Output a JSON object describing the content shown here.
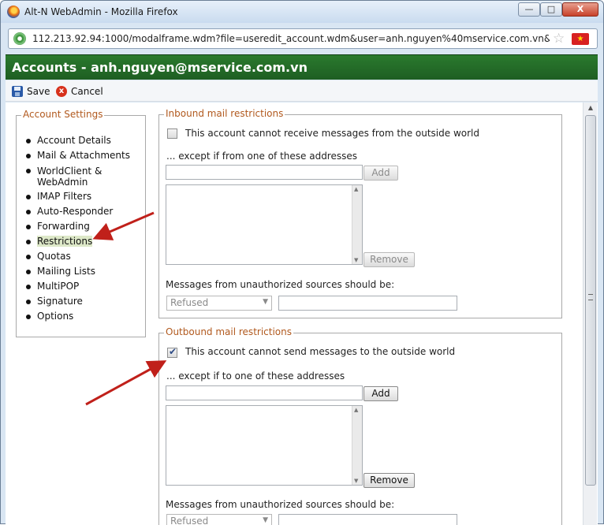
{
  "window": {
    "title": "Alt-N WebAdmin - Mozilla Firefox",
    "min_glyph": "—",
    "max_glyph": "□",
    "close_glyph": "X"
  },
  "address_bar": {
    "url": "112.213.92.94:1000/modalframe.wdm?file=useredit_account.wdm&user=anh.nguyen%40mservice.com.vn&domain=mserv",
    "star_glyph": "☆",
    "flag_glyph": "★"
  },
  "page": {
    "title": "Accounts - anh.nguyen@mservice.com.vn"
  },
  "toolbar": {
    "save_label": "Save",
    "cancel_label": "Cancel",
    "cancel_glyph": "x"
  },
  "nav": {
    "legend": "Account Settings",
    "items": [
      {
        "label": "Account Details"
      },
      {
        "label": "Mail & Attachments"
      },
      {
        "label": "WorldClient & WebAdmin"
      },
      {
        "label": "IMAP Filters"
      },
      {
        "label": "Auto-Responder"
      },
      {
        "label": "Forwarding"
      },
      {
        "label": "Restrictions",
        "active": true
      },
      {
        "label": "Quotas"
      },
      {
        "label": "Mailing Lists"
      },
      {
        "label": "MultiPOP"
      },
      {
        "label": "Signature"
      },
      {
        "label": "Options"
      }
    ]
  },
  "inbound": {
    "legend": "Inbound mail restrictions",
    "checkbox_label": "This account cannot receive messages from the outside world",
    "checked": false,
    "except_label": "... except if from one of these addresses",
    "address_value": "",
    "add_label": "Add",
    "remove_label": "Remove",
    "unauth_label": "Messages from unauthorized sources should be:",
    "unauth_selected": "Refused",
    "extra_value": ""
  },
  "outbound": {
    "legend": "Outbound mail restrictions",
    "checkbox_label": "This account cannot send messages to the outside world",
    "checked": true,
    "except_label": "... except if to one of these addresses",
    "address_value": "",
    "add_label": "Add",
    "remove_label": "Remove",
    "unauth_label": "Messages from unauthorized sources should be:",
    "unauth_selected": "Refused",
    "extra_value": ""
  },
  "colors": {
    "header_green": "#1e5e22",
    "legend_orange": "#b1591e",
    "arrow_red": "#c0201a"
  }
}
